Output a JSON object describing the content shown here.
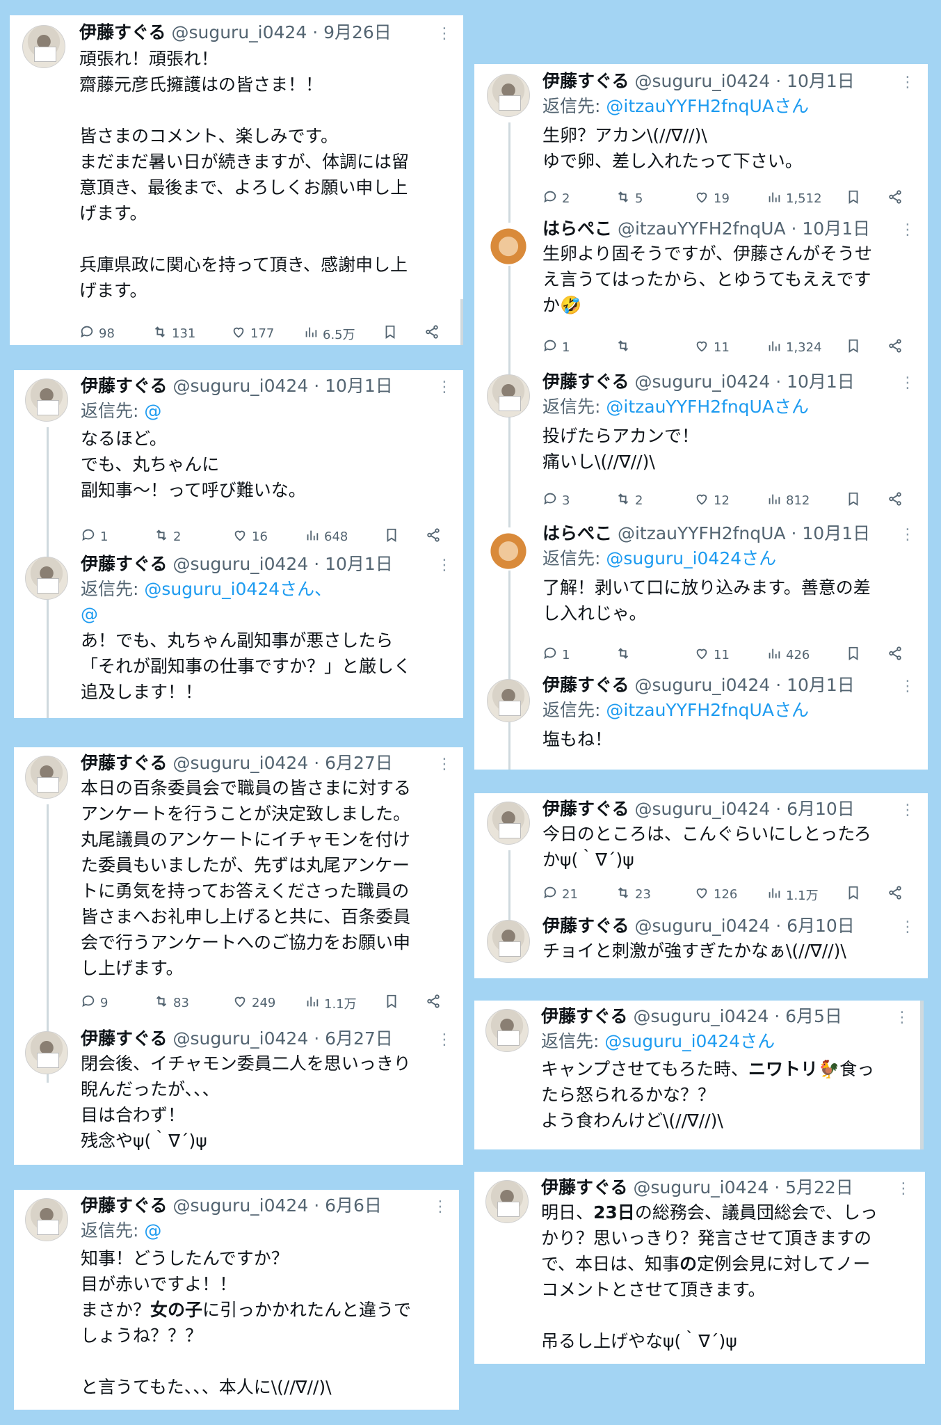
{
  "tweets": {
    "t1": {
      "name": "伊藤すぐる",
      "handle": "@suguru_i0424 · 9月26日",
      "text": "頑張れ！頑張れ！\n齋藤元彦氏擁護はの皆さま！！\n\n皆さまのコメント、楽しみです。\nまだまだ暑い日が続きますが、体調には留\n意頂き、最後まで、よろしくお願い申し上\nげます。\n\n兵庫県政に関心を持って頂き、感謝申し上\nげます。",
      "replies": "98",
      "retweets": "131",
      "likes": "177",
      "views": "6.5万"
    },
    "t2": {
      "name": "伊藤すぐる",
      "handle": "@suguru_i0424 · 10月1日",
      "reply_prefix": "返信先: ",
      "reply_to": "@",
      "text": "なるほど。\nでも、丸ちゃんに\n副知事〜！って呼び難いな。",
      "replies": "1",
      "retweets": "2",
      "likes": "16",
      "views": "648"
    },
    "t3": {
      "name": "伊藤すぐる",
      "handle": "@suguru_i0424 · 10月1日",
      "reply_prefix": "返信先: ",
      "reply_to": "@suguru_i0424さん、",
      "reply_to2": "@",
      "text": "あ！でも、丸ちゃん副知事が悪さしたら\n「それが副知事の仕事ですか？」と厳しく\n追及します！！"
    },
    "t4": {
      "name": "伊藤すぐる",
      "handle": "@suguru_i0424 · 6月27日",
      "text": "本日の百条委員会で職員の皆さまに対する\nアンケートを行うことが決定致しました。\n丸尾議員のアンケートにイチャモンを付け\nた委員もいましたが、先ずは丸尾アンケー\nトに勇気を持ってお答えくださった職員の\n皆さまへお礼申し上げると共に、百条委員\n会で行うアンケートへのご協力をお願い申\nし上げます。",
      "replies": "9",
      "retweets": "83",
      "likes": "249",
      "views": "1.1万"
    },
    "t5": {
      "name": "伊藤すぐる",
      "handle": "@suguru_i0424 · 6月27日",
      "text": "閉会後、イチャモン委員二人を思いっきり\n睨んだったが、、、\n目は合わず！\n残念やψ(｀∇´)ψ"
    },
    "t6": {
      "name": "伊藤すぐる",
      "handle": "@suguru_i0424 · 6月6日",
      "reply_prefix": "返信先: ",
      "reply_to": "@",
      "text_a": "知事！どうしたんですか？\n目が赤いですよ！！\nまさか？",
      "text_bold": "女の子",
      "text_b": "に引っかかれたんと違うで\nしょうね？？？\n\nと言うてもた、、、本人に\\(//∇//)\\"
    },
    "t7": {
      "name": "伊藤すぐる",
      "handle": "@suguru_i0424 · 10月1日",
      "reply_prefix": "返信先: ",
      "reply_to": "@itzauYYFH2fnqUAさん",
      "text": "生卵？アカン\\(//∇//)\\\nゆで卵、差し入れたって下さい。",
      "replies": "2",
      "retweets": "5",
      "likes": "19",
      "views": "1,512"
    },
    "t8": {
      "name": "はらぺこ",
      "handle": "@itzauYYFH2fnqUA · 10月1日",
      "text": "生卵より固そうですが、伊藤さんがそうせ\nえ言うてはったから、とゆうてもええです\nか🤣",
      "replies": "1",
      "retweets": "",
      "likes": "11",
      "views": "1,324"
    },
    "t9": {
      "name": "伊藤すぐる",
      "handle": "@suguru_i0424 · 10月1日",
      "reply_prefix": "返信先: ",
      "reply_to": "@itzauYYFH2fnqUAさん",
      "text": "投げたらアカンで！\n痛いし\\(//∇//)\\",
      "replies": "3",
      "retweets": "2",
      "likes": "12",
      "views": "812"
    },
    "t10": {
      "name": "はらぺこ",
      "handle": "@itzauYYFH2fnqUA · 10月1日",
      "reply_prefix": "返信先: ",
      "reply_to": "@suguru_i0424さん",
      "text": "了解！剥いて口に放り込みます。善意の差\nし入れじゃ。",
      "replies": "1",
      "retweets": "",
      "likes": "11",
      "views": "426"
    },
    "t11": {
      "name": "伊藤すぐる",
      "handle": "@suguru_i0424 · 10月1日",
      "reply_prefix": "返信先: ",
      "reply_to": "@itzauYYFH2fnqUAさん",
      "text": "塩もね！"
    },
    "t12": {
      "name": "伊藤すぐる",
      "handle": "@suguru_i0424 · 6月10日",
      "text": "今日のところは、こんぐらいにしとったろ\nかψ(｀∇´)ψ",
      "replies": "21",
      "retweets": "23",
      "likes": "126",
      "views": "1.1万"
    },
    "t13": {
      "name": "伊藤すぐる",
      "handle": "@suguru_i0424 · 6月10日",
      "text": "チョイと刺激が強すぎたかなぁ\\(//∇//)\\"
    },
    "t14": {
      "name": "伊藤すぐる",
      "handle": "@suguru_i0424 · 6月5日",
      "reply_prefix": "返信先: ",
      "reply_to": "@suguru_i0424さん",
      "text_a": "キャンプさせてもろた時、",
      "text_bold": "ニワトリ",
      "text_b": "🐓食っ\nたら怒られるかな？？\nよう食わんけど\\(//∇//)\\"
    },
    "t15": {
      "name": "伊藤すぐる",
      "handle": "@suguru_i0424 · 5月22日",
      "text_a": "明日、",
      "text_bold": "23日",
      "text_b": "の総務会、議員団総会で、しっ\nかり？思いっきり？発言させて頂きますの\nで、本日は、知事",
      "text_bold2": "の",
      "text_c": "定例会見に対してノー\nコメントとさせて頂きます。\n\n吊るし上げやなψ(｀∇´)ψ"
    }
  },
  "icons": [
    "reply-icon",
    "retweet-icon",
    "like-icon",
    "views-icon",
    "bookmark-icon",
    "share-icon",
    "more-icon"
  ],
  "colors": {
    "background": "#a3d4f3",
    "link": "#1d9bf0",
    "muted": "#536471"
  }
}
